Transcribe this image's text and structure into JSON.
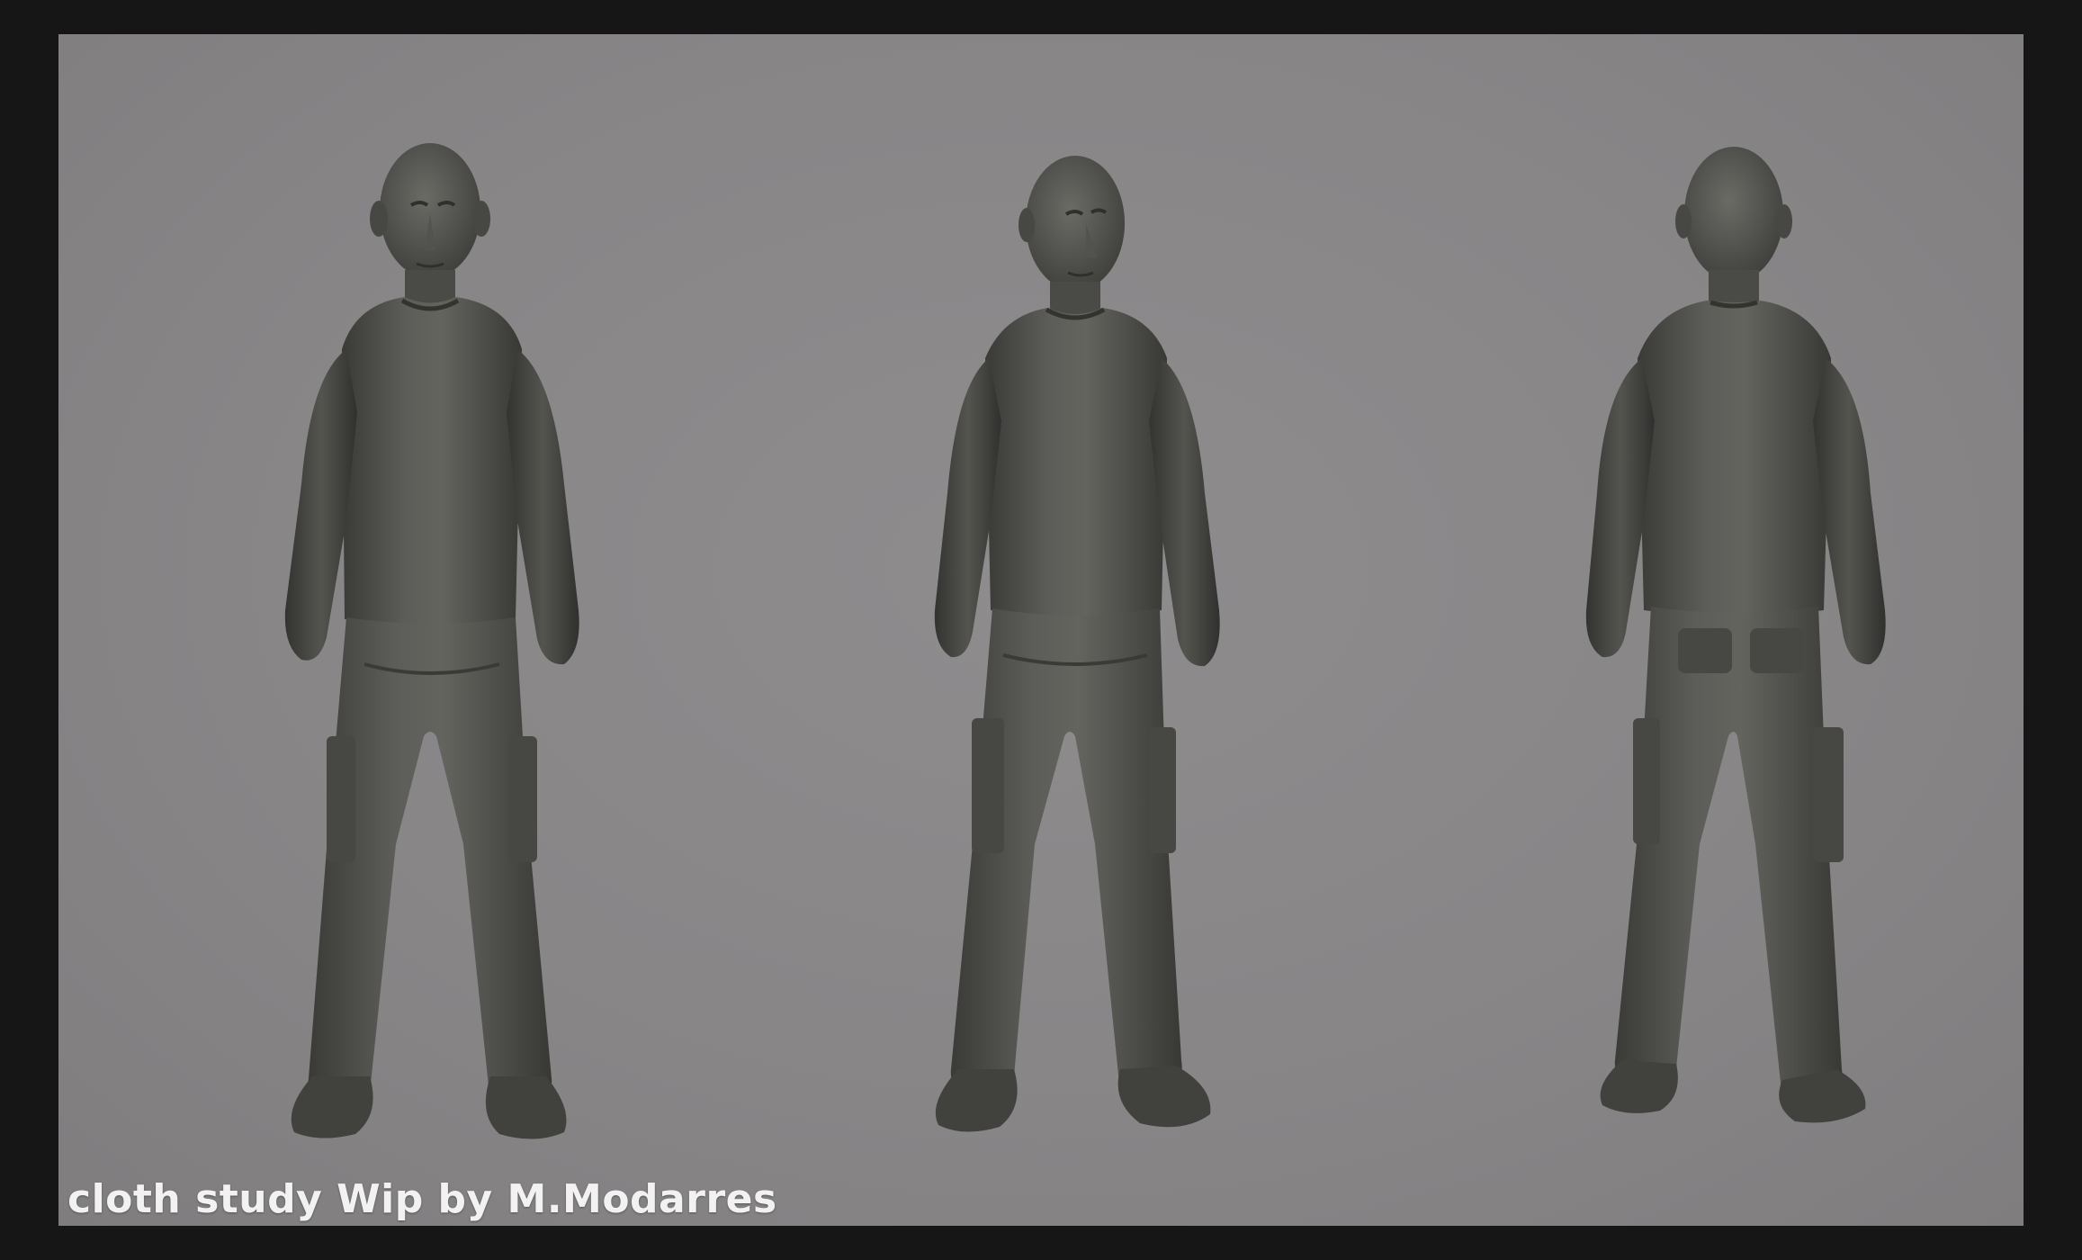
{
  "caption": "cloth study Wip by M.Modarres",
  "colors": {
    "outer_border": "#161616",
    "backdrop": "#878586",
    "sculpt_base": "#4b4b48",
    "sculpt_highlight": "#6a6a66",
    "sculpt_shadow": "#2c2c2a",
    "caption_text": "#f2f2f2"
  },
  "views": [
    {
      "name": "front-view"
    },
    {
      "name": "three-quarter-view"
    },
    {
      "name": "back-view"
    }
  ]
}
